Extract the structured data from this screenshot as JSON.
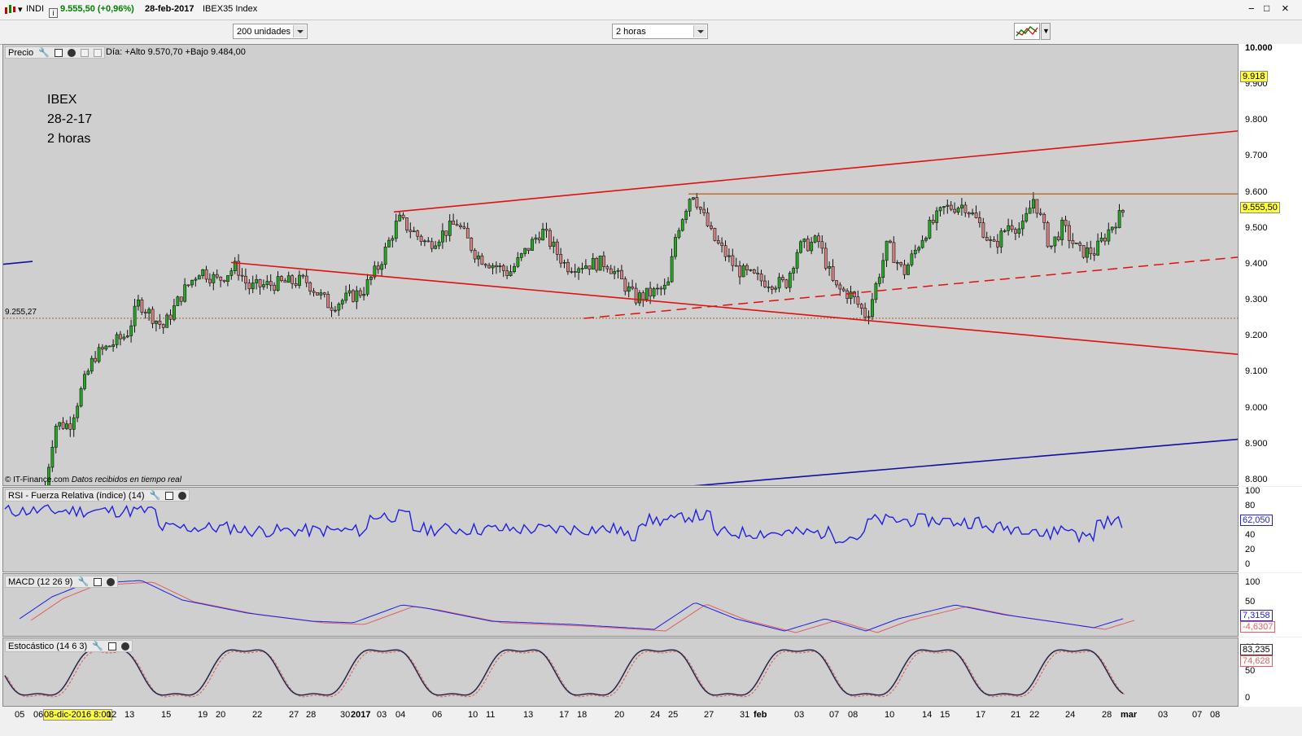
{
  "titlebar": {
    "symbol": "INDI",
    "price": "9.555,50 (+0,96%)",
    "date": "28-feb-2017",
    "index": "IBEX35 Index",
    "minimize": "−",
    "maximize": "□",
    "close": "×"
  },
  "toolbar": {
    "units_select": "200 unidades",
    "interval_select": "2 horas"
  },
  "price_panel": {
    "title": "Precio",
    "day_info": "Día: +Alto 9.570,70 +Bajo 9.484,00",
    "annotation_lines": [
      "IBEX",
      "28-2-17",
      "2 horas"
    ],
    "credit": "© IT-Finance.com",
    "credit_note": "Datos recibidos en tiempo real",
    "level_label": "9.255,27",
    "axis_ticks": [
      "10.000",
      "9.900",
      "9.800",
      "9.700",
      "9.600",
      "9.500",
      "9.400",
      "9.300",
      "9.200",
      "9.100",
      "9.000",
      "8.900",
      "8.800"
    ],
    "flag_top": "9.918",
    "flag_current": "9.555,50"
  },
  "rsi_panel": {
    "title": "RSI - Fuerza Relativa (índice) (14)",
    "axis_ticks": [
      "100",
      "80",
      "60",
      "40",
      "20",
      "0"
    ],
    "value": "62,050"
  },
  "macd_panel": {
    "title": "MACD (12 26 9)",
    "axis_ticks": [
      "100",
      "50",
      "0"
    ],
    "value_macd": "7,3158",
    "value_signal": "-4,6307"
  },
  "stoch_panel": {
    "title": "Estocástico (14 6 3)",
    "axis_ticks": [
      "100",
      "50",
      "0"
    ],
    "value_k": "83,235",
    "value_d": "74,628"
  },
  "x_axis": {
    "labels": [
      "05",
      "06",
      "08-dic-2016 8:00",
      "12",
      "13",
      "15",
      "19",
      "20",
      "22",
      "27",
      "28",
      "30",
      "2017",
      "03",
      "04",
      "06",
      "10",
      "11",
      "13",
      "17",
      "18",
      "20",
      "24",
      "25",
      "27",
      "31",
      "feb",
      "03",
      "07",
      "08",
      "10",
      "14",
      "15",
      "17",
      "21",
      "22",
      "24",
      "28",
      "mar",
      "03",
      "07",
      "08"
    ]
  },
  "colors": {
    "bull_candle": "#22aa22",
    "bear_candle": "#d98080",
    "resistance_line": "#e01010",
    "support_line": "#1010a0",
    "horizontal_line": "#b05000",
    "rsi_line": "#2020e0",
    "flag": "#ffff40"
  }
}
